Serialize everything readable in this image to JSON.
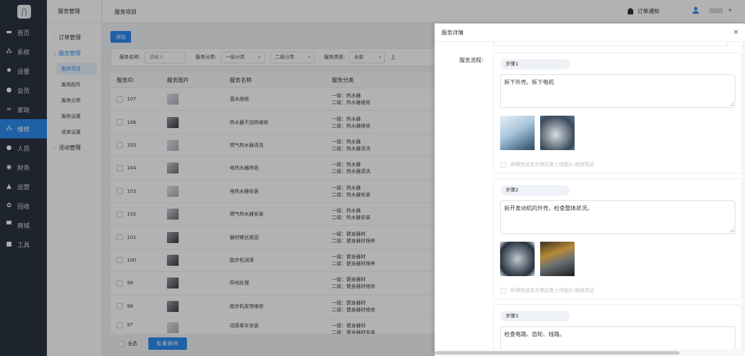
{
  "sidebar": {
    "items": [
      {
        "label": "首页",
        "icon": "monitor-icon"
      },
      {
        "label": "系统",
        "icon": "network-icon"
      },
      {
        "label": "设置",
        "icon": "gear-icon"
      },
      {
        "label": "会员",
        "icon": "user-icon"
      },
      {
        "label": "家政",
        "icon": "link-icon"
      },
      {
        "label": "维修",
        "icon": "network-icon",
        "active": true
      },
      {
        "label": "人员",
        "icon": "user-icon"
      },
      {
        "label": "财务",
        "icon": "coin-icon"
      },
      {
        "label": "运营",
        "icon": "fire-icon"
      },
      {
        "label": "回收",
        "icon": "recycle-icon"
      },
      {
        "label": "商城",
        "icon": "store-icon"
      },
      {
        "label": "工具",
        "icon": "toolbox-icon"
      }
    ]
  },
  "subnav": {
    "title": "服务管理",
    "order": "订单管理",
    "service": "服务管理",
    "leaves": [
      "服务项目",
      "服务配件",
      "服务分类",
      "服务设置",
      "退单设置"
    ],
    "activity": "活动管理"
  },
  "topbar": {
    "breadcrumb": "服务项目",
    "notice": "订单通知"
  },
  "main": {
    "add_label": "添加",
    "filter": {
      "name_label": "服务名称:",
      "name_placeholder": "请输入",
      "cat_label": "服务分类:",
      "cat1": "一级分类",
      "cat2": "二级分类",
      "type_label": "服务类型:",
      "type_value": "全部",
      "trailing": "上"
    },
    "headers": [
      "服务ID",
      "服务图片",
      "服务名称",
      "服务分类"
    ],
    "rows": [
      {
        "id": "107",
        "name": "漏水维修",
        "l1": "一级：热水器",
        "l2": "二级：热水器维修"
      },
      {
        "id": "106",
        "name": "热水器不加热维修",
        "l1": "一级：热水器",
        "l2": "二级：热水器维修"
      },
      {
        "id": "105",
        "name": "燃气热水器清洗",
        "l1": "一级：热水器",
        "l2": "二级：热水器清洗"
      },
      {
        "id": "104",
        "name": "电热水器除垢",
        "l1": "一级：热水器",
        "l2": "二级：热水器清洗"
      },
      {
        "id": "103",
        "name": "电热水器安装",
        "l1": "一级：热水器",
        "l2": "二级：热水器安装"
      },
      {
        "id": "102",
        "name": "燃气热水器安装",
        "l1": "一级：热水器",
        "l2": "二级：热水器安装"
      },
      {
        "id": "101",
        "name": "器材螺丝紧固",
        "l1": "一级：健身器材",
        "l2": "二级：健身器材保养"
      },
      {
        "id": "100",
        "name": "跑步机润滑",
        "l1": "一级：健身器材",
        "l2": "二级：健身器材保养"
      },
      {
        "id": "99",
        "name": "异响处理",
        "l1": "一级：健身器材",
        "l2": "二级：健身器材维修"
      },
      {
        "id": "98",
        "name": "跑步机皮带维修",
        "l1": "一级：健身器材",
        "l2": "二级：健身器材维修"
      },
      {
        "id": "97",
        "name": "动感单车安装",
        "l1": "一级：健身器材",
        "l2": "二级：健身器材安装"
      }
    ],
    "footer": {
      "select_all": "全选",
      "batch_delete": "批量删除"
    }
  },
  "drawer": {
    "title": "服务详情",
    "flow_label": "服务流程:",
    "steps": [
      {
        "tag": "步骤1",
        "text": "拆下外壳、拆下电机",
        "checkbox": "师傅完成本步骤后需上传图片/视频凭证"
      },
      {
        "tag": "步骤2",
        "text": "拆开发动机的外壳，检查整体状况。",
        "checkbox": "师傅完成本步骤后需上传图片/视频凭证"
      },
      {
        "tag": "步骤3",
        "text": "检查电路、齿轮、线路。"
      }
    ]
  },
  "colors": {
    "accent": "#2d8cf0",
    "sidebar": "#2b3443"
  }
}
